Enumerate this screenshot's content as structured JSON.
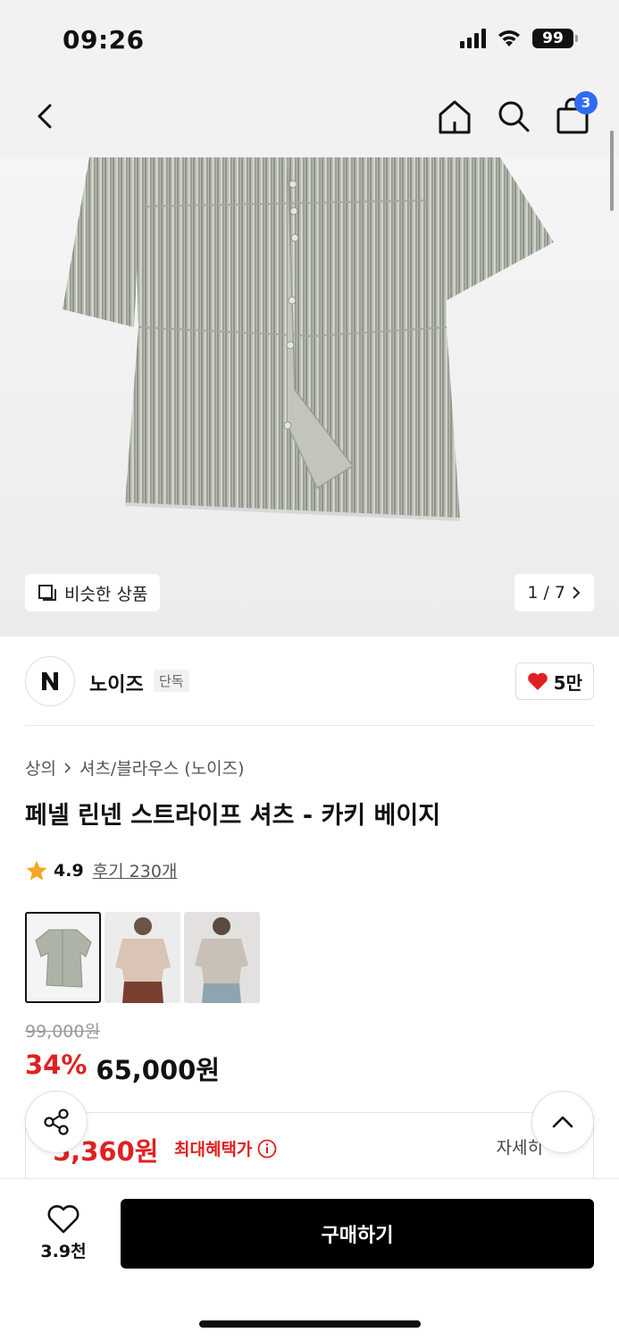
{
  "status_bar": {
    "time": "09:26",
    "battery": "99"
  },
  "nav": {
    "cart_count": "3"
  },
  "hero": {
    "similar_label": "비슷한 상품",
    "pager": "1 / 7"
  },
  "brand": {
    "name": "노이즈",
    "tag": "단독",
    "likes": "5만"
  },
  "product": {
    "breadcrumb": [
      "상의",
      "셔츠/블라우스 (노이즈)"
    ],
    "title": "페넬 린넨 스트라이프 셔츠 - 카키 베이지",
    "rating": "4.9",
    "review_text": "후기 230개",
    "thumbnails": [
      "product-flat-khaki",
      "model-front-beige",
      "model-side-beige"
    ],
    "original_price": "99,000원",
    "discount": "34%",
    "price": "65,000원"
  },
  "benefit": {
    "price": "5,360원",
    "label": "최대혜택가",
    "detail": "자세히"
  },
  "bottom": {
    "wish_count": "3.9천",
    "buy_label": "구매하기"
  },
  "colors": {
    "accent_red": "#e02020",
    "badge_blue": "#2f6bf2"
  }
}
